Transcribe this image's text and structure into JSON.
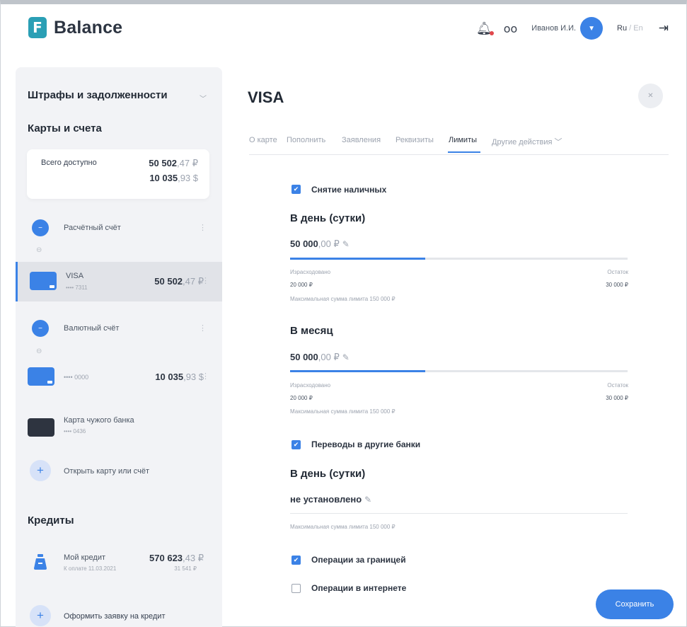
{
  "header": {
    "logo_letter": "F",
    "app_name": "Balance",
    "user_name": "Иванов И.И.",
    "lang_active": "Ru",
    "lang_sep": " / ",
    "lang_other": "En"
  },
  "sidebar": {
    "fines": "Штрафы и задолженности",
    "cards_title": "Карты и счета",
    "available": {
      "label": "Всего доступно",
      "v1_int": "50 502",
      "v1_dec": ",47 ₽",
      "v2_int": "10 035",
      "v2_dec": ",93 $"
    },
    "accounts": [
      {
        "title": "Расчётный счёт"
      },
      {
        "title": "VISA",
        "sub": "•••• 7311",
        "amt_int": "50 502",
        "amt_dec": ",47 ₽"
      },
      {
        "title": "Валютный счёт"
      },
      {
        "title": "•••• 0000",
        "amt_int": "10 035",
        "amt_dec": ",93 $"
      },
      {
        "title": "Карта чужого банка",
        "sub": "•••• 0436"
      }
    ],
    "open_card": "Открыть карту или счёт",
    "credits_title": "Кредиты",
    "credit": {
      "title": "Мой кредит",
      "sub": "К оплате 11.03.2021",
      "amt_int": "570 623",
      "amt_dec": ",43 ₽",
      "payment": "31 541 ₽"
    },
    "apply_credit": "Оформить заявку на кредит"
  },
  "main": {
    "title": "VISA",
    "tabs": [
      "О карте",
      "Пополнить",
      "Заявления",
      "Реквизиты",
      "Лимиты",
      "Другие действия"
    ],
    "active_tab": "Лимиты",
    "cash": {
      "label": "Снятие наличных",
      "checked": true,
      "day": {
        "heading": "В день (сутки)",
        "amt_int": "50 000",
        "amt_dec": ",00 ₽",
        "progress": 0.4,
        "spent_label": "Израсходовано",
        "spent": "20 000 ₽",
        "left_label": "Остаток",
        "left": "30 000 ₽",
        "max": "Максимальная сумма лимита 150 000 ₽"
      },
      "month": {
        "heading": "В месяц",
        "amt_int": "50 000",
        "amt_dec": ",00 ₽",
        "progress": 0.4,
        "spent_label": "Израсходовано",
        "spent": "20 000 ₽",
        "left_label": "Остаток",
        "left": "30 000 ₽",
        "max": "Максимальная сумма лимита 150 000 ₽"
      }
    },
    "transfers": {
      "label": "Переводы в другие банки",
      "checked": true,
      "day": {
        "heading": "В день (сутки)",
        "value": "не установлено",
        "max": "Максимальная сумма лимита 150 000 ₽"
      }
    },
    "abroad": {
      "label": "Операции за границей",
      "checked": true
    },
    "internet": {
      "label": "Операции в интернете",
      "checked": false
    },
    "save": "Сохранить"
  },
  "colors": {
    "accent": "#3b82e6",
    "logo": "#2a9fb5"
  }
}
